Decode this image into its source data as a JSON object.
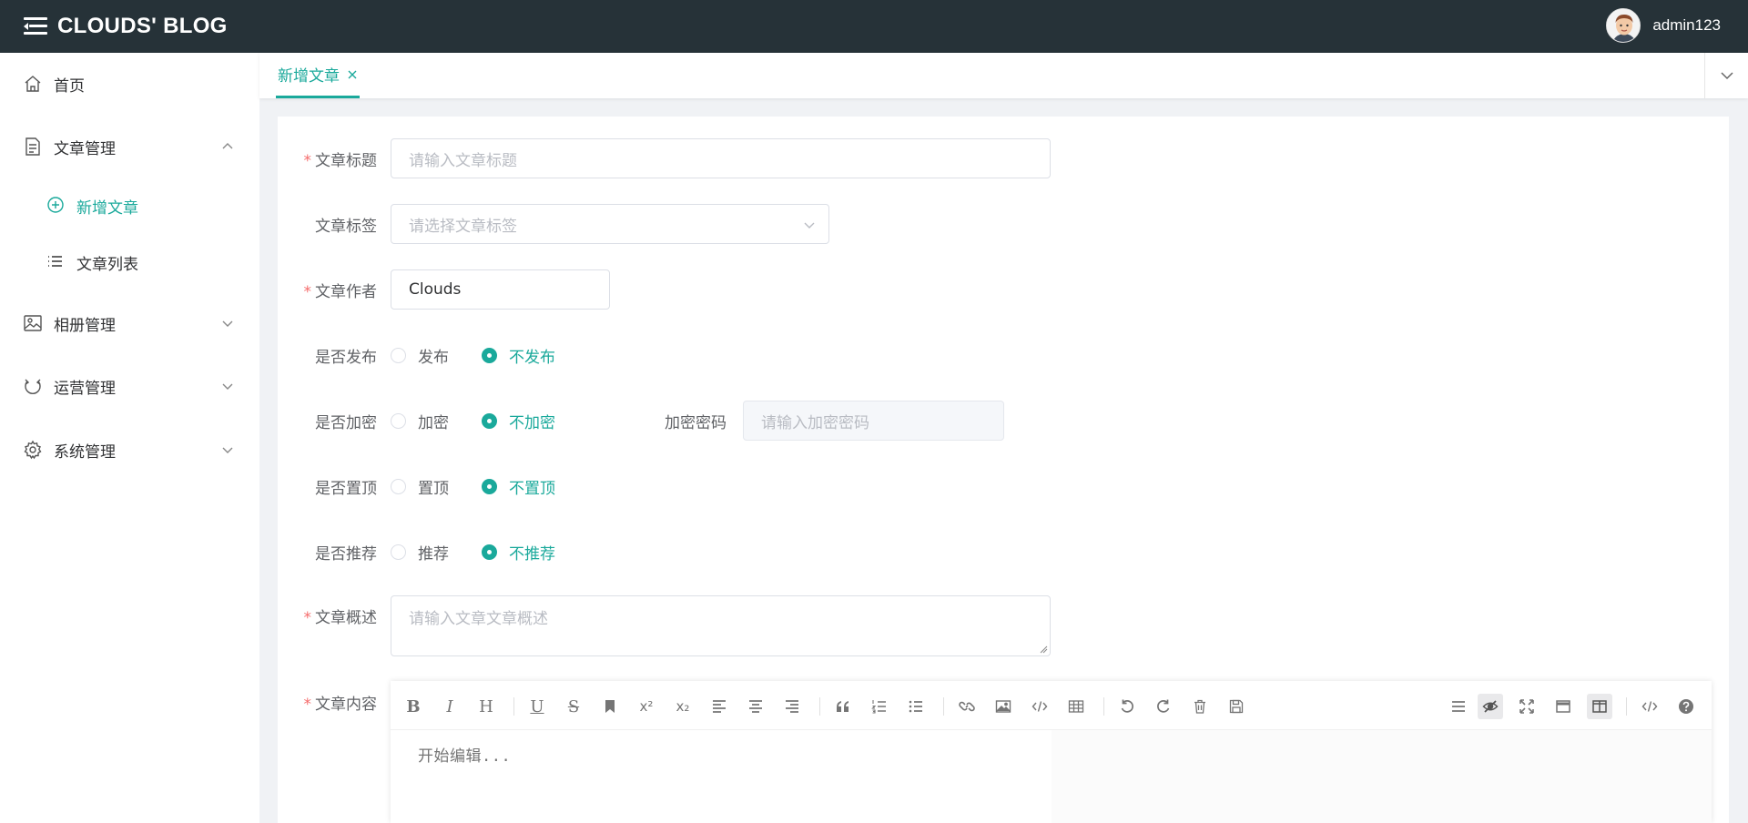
{
  "header": {
    "brand": "CLOUDS' BLOG",
    "username": "admin123",
    "bg_color": "#263238"
  },
  "sidebar": {
    "items": [
      {
        "label": "首页",
        "icon": "home-icon"
      },
      {
        "label": "文章管理",
        "icon": "document-icon",
        "expanded": true
      },
      {
        "label": "新增文章",
        "icon": "circle-plus-icon",
        "active": true
      },
      {
        "label": "文章列表",
        "icon": "list-icon"
      },
      {
        "label": "相册管理",
        "icon": "picture-icon"
      },
      {
        "label": "运营管理",
        "icon": "refresh-icon"
      },
      {
        "label": "系统管理",
        "icon": "gear-icon"
      }
    ]
  },
  "tabs": [
    {
      "label": "新增文章",
      "active": true
    }
  ],
  "form": {
    "title": {
      "label": "文章标题",
      "placeholder": "请输入文章标题",
      "required": true
    },
    "tags": {
      "label": "文章标签",
      "placeholder": "请选择文章标签"
    },
    "author": {
      "label": "文章作者",
      "value": "Clouds",
      "required": true
    },
    "publish": {
      "label": "是否发布",
      "options": [
        "发布",
        "不发布"
      ],
      "selected": "不发布"
    },
    "encrypt": {
      "label": "是否加密",
      "options": [
        "加密",
        "不加密"
      ],
      "selected": "不加密",
      "password_label": "加密密码",
      "password_placeholder": "请输入加密密码"
    },
    "top": {
      "label": "是否置顶",
      "options": [
        "置顶",
        "不置顶"
      ],
      "selected": "不置顶"
    },
    "recommend": {
      "label": "是否推荐",
      "options": [
        "推荐",
        "不推荐"
      ],
      "selected": "不推荐"
    },
    "summary": {
      "label": "文章概述",
      "placeholder": "请输入文章文章概述",
      "required": true
    },
    "content": {
      "label": "文章内容",
      "placeholder": "开始编辑...",
      "required": true
    }
  },
  "editor_toolbar": {
    "bold": "B",
    "italic": "I",
    "heading": "H",
    "underline": "U",
    "strike": "S",
    "superscript": "x²",
    "subscript": "x₂"
  },
  "colors": {
    "accent": "#1aa99b",
    "required": "#f56c6c"
  }
}
